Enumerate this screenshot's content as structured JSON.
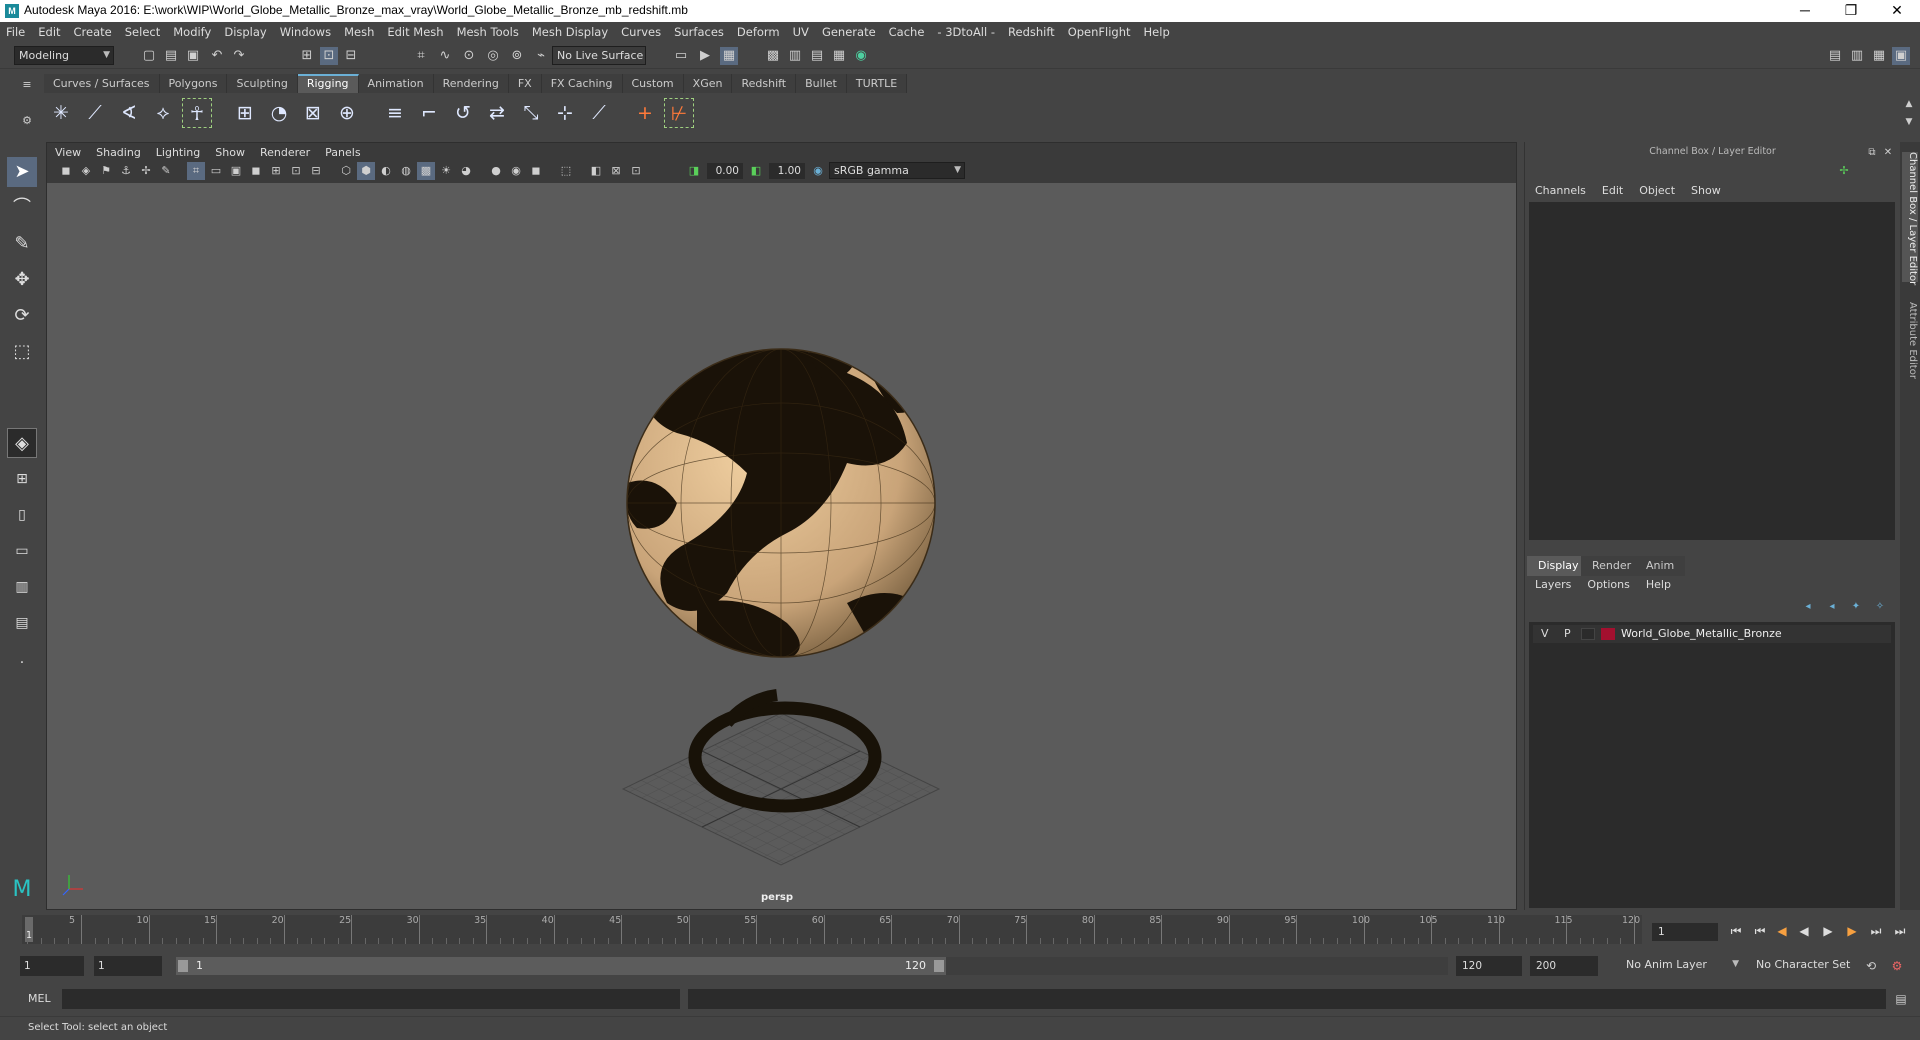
{
  "window": {
    "title": "Autodesk Maya 2016: E:\\work\\WIP\\World_Globe_Metallic_Bronze_max_vray\\World_Globe_Metallic_Bronze_mb_redshift.mb",
    "minimize": "─",
    "maximize": "❐",
    "close": "✕"
  },
  "menubar": [
    "File",
    "Edit",
    "Create",
    "Select",
    "Modify",
    "Display",
    "Windows",
    "Mesh",
    "Edit Mesh",
    "Mesh Tools",
    "Mesh Display",
    "Curves",
    "Surfaces",
    "Deform",
    "UV",
    "Generate",
    "Cache",
    "- 3DtoAll -",
    "Redshift",
    "OpenFlight",
    "Help"
  ],
  "statusline": {
    "mode": "Modeling",
    "live_surface": "No Live Surface"
  },
  "shelf_tabs": [
    "Curves / Surfaces",
    "Polygons",
    "Sculpting",
    "Rigging",
    "Animation",
    "Rendering",
    "FX",
    "FX Caching",
    "Custom",
    "XGen",
    "Redshift",
    "Bullet",
    "TURTLE"
  ],
  "shelf_active": "Rigging",
  "viewport": {
    "menu": [
      "View",
      "Shading",
      "Lighting",
      "Show",
      "Renderer",
      "Panels"
    ],
    "exposure": "0.00",
    "gamma": "1.00",
    "color_space": "sRGB gamma",
    "camera": "persp"
  },
  "channel_box": {
    "title": "Channel Box / Layer Editor",
    "menu": [
      "Channels",
      "Edit",
      "Object",
      "Show"
    ]
  },
  "layer_editor": {
    "tabs": [
      "Display",
      "Render",
      "Anim"
    ],
    "menu": [
      "Layers",
      "Options",
      "Help"
    ],
    "layer": {
      "v": "V",
      "p": "P",
      "name": "World_Globe_Metallic_Bronze",
      "color": "#a3102f"
    }
  },
  "side_tabs": {
    "channel": "Channel Box / Layer Editor",
    "attr": "Attribute Editor"
  },
  "timeline": {
    "ticks": [
      "5",
      "10",
      "15",
      "20",
      "25",
      "30",
      "35",
      "40",
      "45",
      "50",
      "55",
      "60",
      "65",
      "70",
      "75",
      "80",
      "85",
      "90",
      "95",
      "100",
      "105",
      "110",
      "115",
      "120"
    ],
    "current": "1",
    "current_field": "1"
  },
  "range": {
    "start": "1",
    "playback_start": "1",
    "slider_start": "1",
    "slider_end": "120",
    "playback_end": "120",
    "end": "200",
    "anim_layer": "No Anim Layer",
    "char_set": "No Character Set"
  },
  "cmdline": {
    "label": "MEL"
  },
  "helpline": "Select Tool: select an object",
  "accent": "#6bb0d6"
}
